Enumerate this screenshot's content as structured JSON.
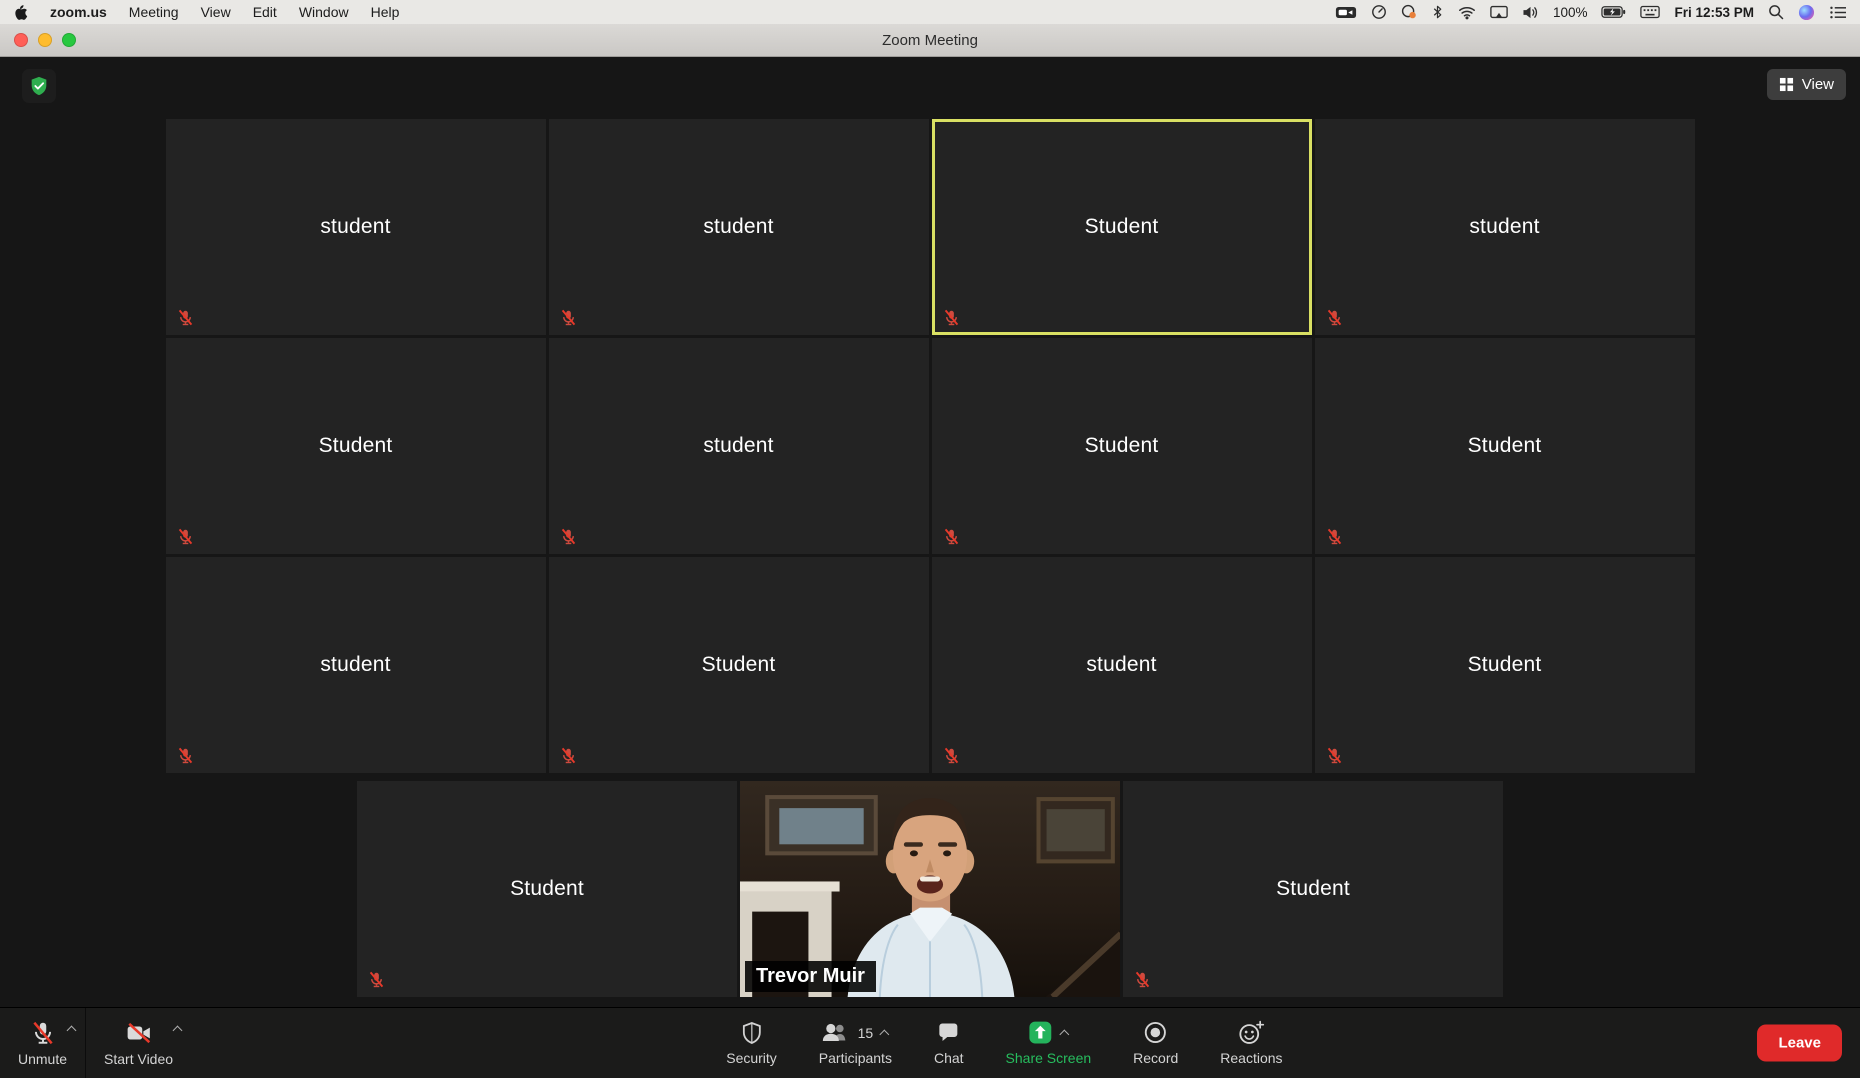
{
  "colors": {
    "active_speaker_border": "#d9e063",
    "share_green": "#27bd5e",
    "leave_red": "#e02a2a",
    "mute_red": "#e8392a",
    "tile_bg": "#232323",
    "stage_bg": "#161616"
  },
  "menubar": {
    "app_name": "zoom.us",
    "items": [
      "Meeting",
      "View",
      "Edit",
      "Window",
      "Help"
    ],
    "battery": "100%",
    "clock": "Fri 12:53 PM",
    "status_icons": [
      "zoom-camera",
      "gauge",
      "status-orange-dot",
      "bluetooth",
      "wifi",
      "display-mirroring",
      "volume",
      "battery-charging",
      "keyboard",
      "search",
      "siri",
      "menu-list"
    ]
  },
  "titlebar": {
    "title": "Zoom Meeting"
  },
  "stage": {
    "view_button": "View",
    "encryption_icon": "shield-check"
  },
  "meeting": {
    "rows": [
      {
        "tiles": [
          {
            "name": "student",
            "muted": true
          },
          {
            "name": "student",
            "muted": true
          },
          {
            "name": "Student",
            "muted": true,
            "active": true
          },
          {
            "name": "student",
            "muted": true
          }
        ]
      },
      {
        "tiles": [
          {
            "name": "Student",
            "muted": true
          },
          {
            "name": "student",
            "muted": true
          },
          {
            "name": "Student",
            "muted": true
          },
          {
            "name": "Student",
            "muted": true
          }
        ]
      },
      {
        "tiles": [
          {
            "name": "student",
            "muted": true
          },
          {
            "name": "Student",
            "muted": true
          },
          {
            "name": "student",
            "muted": true
          },
          {
            "name": "Student",
            "muted": true
          }
        ]
      },
      {
        "tiles": [
          {
            "name": "Student",
            "muted": true
          },
          {
            "name": "Trevor Muir",
            "muted": false,
            "active": true,
            "video": true
          },
          {
            "name": "Student",
            "muted": true
          }
        ]
      }
    ]
  },
  "toolbar": {
    "unmute": "Unmute",
    "start_video": "Start Video",
    "security": "Security",
    "participants": "Participants",
    "participants_count": "15",
    "chat": "Chat",
    "share_screen": "Share Screen",
    "record": "Record",
    "reactions": "Reactions",
    "leave": "Leave"
  }
}
